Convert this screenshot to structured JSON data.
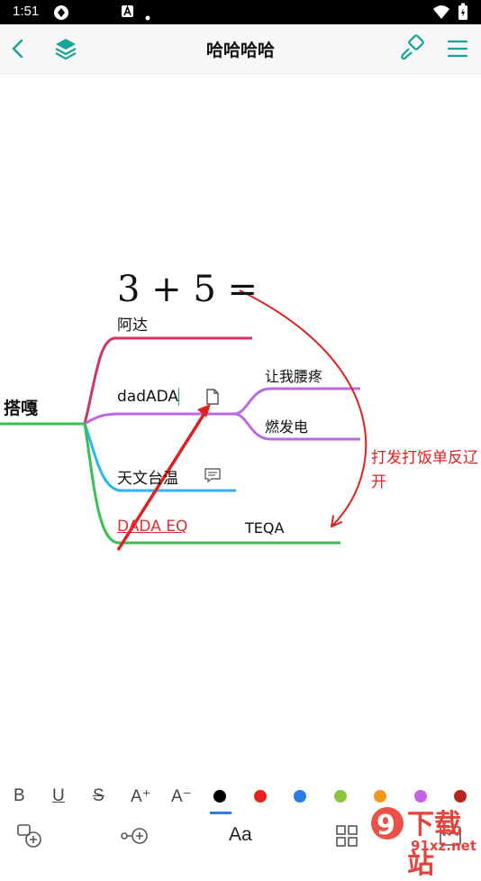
{
  "status": {
    "time": "1:51"
  },
  "header": {
    "title": "哈哈哈哈"
  },
  "mindmap": {
    "root": "搭嘎",
    "formula": "3 + 5 =",
    "branch1": "阿达",
    "branch2": "dadADA",
    "sub1": "让我腰疼",
    "sub2": "燃发电",
    "branch3": "天文台温",
    "branch4_link": "DADA EQ",
    "branch4_text": "TEQA",
    "annotation_line1": "打发打饭单反辽",
    "annotation_line2": "开"
  },
  "format_toolbar": {
    "bold": "B",
    "underline": "U",
    "strike": "S",
    "increase": "A⁺",
    "decrease": "A⁻",
    "colors": [
      "#000000",
      "#e8211c",
      "#2a7de1",
      "#8bc43f",
      "#f39a1e",
      "#c462e8",
      "#b5261e"
    ]
  },
  "bottom_toolbar": {
    "text_style": "Aa"
  },
  "watermark": {
    "line1": "下载站",
    "line2": "91xz.net"
  },
  "accent": "#1aa39a"
}
